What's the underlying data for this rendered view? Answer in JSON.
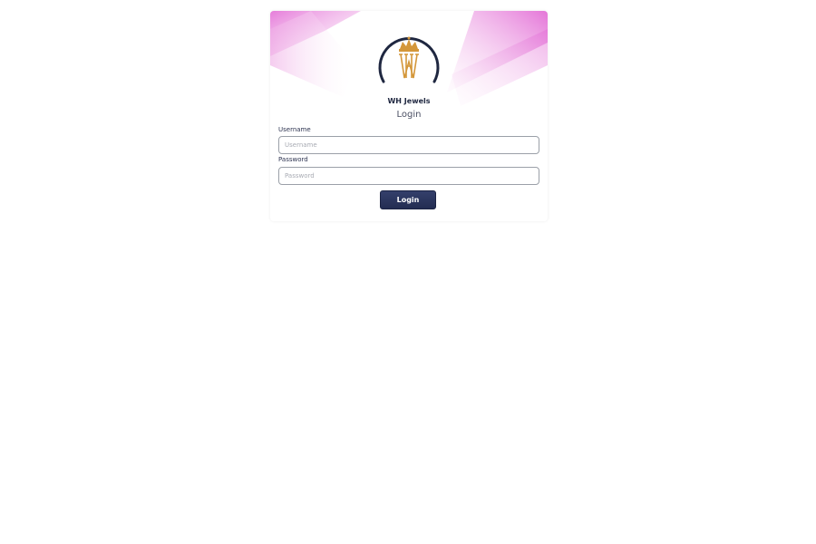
{
  "brand": {
    "name": "WH Jewels",
    "logo_text": "WH"
  },
  "form": {
    "title": "Login",
    "username_label": "Username",
    "username_placeholder": "Username",
    "username_value": "",
    "password_label": "Password",
    "password_placeholder": "Password",
    "password_value": "",
    "submit_label": "Login"
  },
  "colors": {
    "accent_pink": "#e36fd6",
    "navy": "#1f2740",
    "gold": "#d4973a",
    "button": "#2b3660"
  },
  "icons": {
    "logo": "crown-monogram-logo-icon"
  }
}
